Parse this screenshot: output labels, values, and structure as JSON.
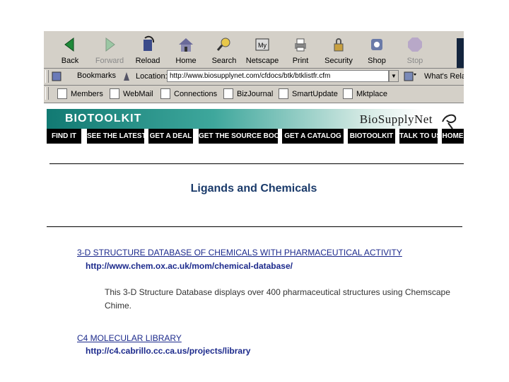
{
  "toolbar": {
    "buttons": [
      {
        "label": "Back",
        "icon": "back-arrow-icon"
      },
      {
        "label": "Forward",
        "icon": "forward-arrow-icon",
        "disabled": true
      },
      {
        "label": "Reload",
        "icon": "reload-icon"
      },
      {
        "label": "Home",
        "icon": "home-icon"
      },
      {
        "label": "Search",
        "icon": "search-icon"
      },
      {
        "label": "Netscape",
        "icon": "netscape-icon"
      },
      {
        "label": "Print",
        "icon": "printer-icon"
      },
      {
        "label": "Security",
        "icon": "lock-icon"
      },
      {
        "label": "Shop",
        "icon": "shop-icon"
      },
      {
        "label": "Stop",
        "icon": "stop-icon",
        "disabled": true
      }
    ]
  },
  "location_bar": {
    "bookmarks_label": "Bookmarks",
    "location_label": "Location:",
    "url": "http://www.biosupplynet.com/cfdocs/btk/btklistfr.cfm",
    "whats_related": "What's Rela"
  },
  "personal_toolbar": {
    "items": [
      "Members",
      "WebMail",
      "Connections",
      "BizJournal",
      "SmartUpdate",
      "Mktplace"
    ]
  },
  "banner": {
    "brand": "BIOTOOLKIT",
    "logo": "BioSupplyNet"
  },
  "nav": {
    "items": [
      "FIND IT",
      "SEE THE LATEST",
      "GET A DEAL",
      "GET THE SOURCE BOOK",
      "GET A CATALOG",
      "BIOTOOLKIT",
      "TALK TO US",
      "HOME"
    ]
  },
  "page": {
    "title": "Ligands and Chemicals",
    "entries": [
      {
        "name": "3-D STRUCTURE DATABASE OF CHEMICALS WITH PHARMACEUTICAL ACTIVITY",
        "url": "http://www.chem.ox.ac.uk/mom/chemical-database/",
        "description_line1": "This 3-D Structure Database displays over 400 pharmaceutical structures using Chemscape",
        "description_line2": "Chime."
      },
      {
        "name": "C4 MOLECULAR LIBRARY",
        "url": "http://c4.cabrillo.cc.ca.us/projects/library"
      }
    ]
  },
  "colors": {
    "chrome": "#d4d0c8",
    "banner_start": "#127a73",
    "nav_bg": "#000000",
    "title": "#1a3a6a",
    "link": "#1c2a8c"
  }
}
